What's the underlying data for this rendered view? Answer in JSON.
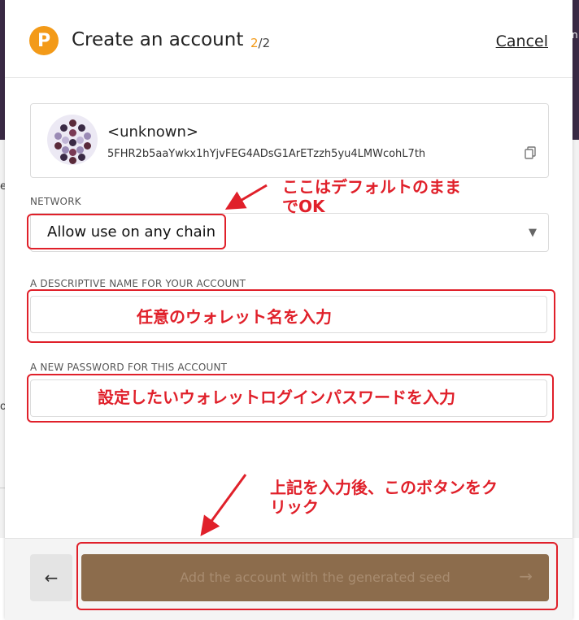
{
  "background": {
    "frag_e": "e",
    "frag_o": "o",
    "frag_n": "n"
  },
  "header": {
    "logo_letter": "P",
    "title": "Create an account",
    "step_current": "2",
    "step_total": "/2",
    "cancel_label": "Cancel"
  },
  "account": {
    "name": "<unknown>",
    "address": "5FHR2b5aaYwkx1hYjvFEG4ADsG1ArETzzh5yu4LMWcohL7th",
    "icons": {
      "identicon": "identicon-avatar",
      "copy": "copy-icon"
    }
  },
  "network": {
    "label": "NETWORK",
    "value": "Allow use on any chain"
  },
  "name_field": {
    "label": "A DESCRIPTIVE NAME FOR YOUR ACCOUNT",
    "value": ""
  },
  "password_field": {
    "label": "A NEW PASSWORD FOR THIS ACCOUNT",
    "value": ""
  },
  "footer": {
    "back_icon": "←",
    "primary_label": "Add the account with the generated seed",
    "primary_arrow": "→"
  },
  "annotations": {
    "network_note": "ここはデフォルトのまま\nでOK",
    "name_note": "任意のウォレット名を入力",
    "password_note": "設定したいウォレットログインパスワードを入力",
    "button_note": "上記を入力後、このボタンをク\nリック"
  },
  "colors": {
    "brand_orange": "#f39a18",
    "primary_button": "#8c6c4c",
    "annotation_red": "#e0202a"
  }
}
